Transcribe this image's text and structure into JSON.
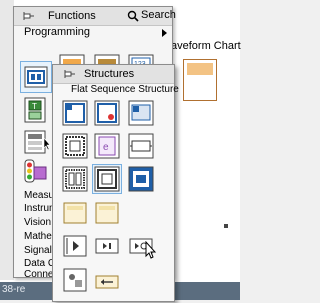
{
  "background": {
    "waveform_chart_caption": "aveform Chart",
    "taskbar_text": "38-re"
  },
  "functions_palette": {
    "title": "Functions",
    "search_label": "Search",
    "category": "Programming",
    "rows": [
      "Measure",
      "Instrume",
      "Vision ar",
      "Mathem",
      "Signal P",
      "Data Co",
      "Connect"
    ],
    "icons": [
      "pin-icon",
      "search-icon",
      "structures-icon",
      "array-icon",
      "cluster-icon",
      "numeric-icon",
      "boolean-icon",
      "string-icon",
      "comparison-icon",
      "timing-icon",
      "dialog-icon",
      "file-io-icon"
    ]
  },
  "structures_palette": {
    "title": "Structures",
    "tooltip": "Flat Sequence Structure",
    "icons": [
      "for-loop-icon",
      "while-loop-icon",
      "timed-structure-icon",
      "case-structure-icon",
      "event-structure-icon",
      "diagram-disable-icon",
      "flat-sequence-icon",
      "stacked-sequence-icon",
      "in-place-element-icon",
      "local-variable-icon",
      "global-variable-icon",
      "feedback-node-icon",
      "shift-register-icon",
      "formula-node-icon",
      "mathscript-icon",
      "shared-variable-icon"
    ]
  },
  "colors": {
    "palette_bg": "#f5f5f5",
    "titlebar_bg": "#e2e2e2",
    "selection_border": "#7ab0e0",
    "taskbar": "#5b6d7f",
    "structure_icon_blue": "#1f5fa8"
  }
}
